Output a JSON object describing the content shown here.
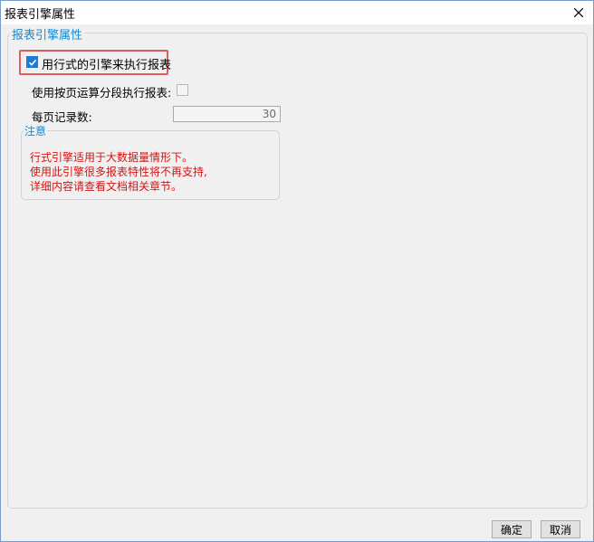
{
  "window": {
    "title": "报表引擎属性",
    "close_icon": "close-icon"
  },
  "group": {
    "legend": "报表引擎属性"
  },
  "row_engine": {
    "checked": true,
    "label": "用行式的引擎来执行报表"
  },
  "paged_exec": {
    "label": "使用按页运算分段执行报表:",
    "checked": false
  },
  "records_per_page": {
    "label": "每页记录数:",
    "value": "30"
  },
  "note": {
    "legend": "注意",
    "lines": [
      "行式引擎适用于大数据量情形下。",
      "使用此引擎很多报表特性将不再支持,",
      "详细内容请查看文档相关章节。"
    ]
  },
  "buttons": {
    "ok": "确定",
    "cancel": "取消"
  },
  "colors": {
    "accent": "#0f8ad6",
    "highlight": "#e05b5b",
    "warning_text": "#d21515",
    "checkbox_checked": "#1e7ad8"
  }
}
